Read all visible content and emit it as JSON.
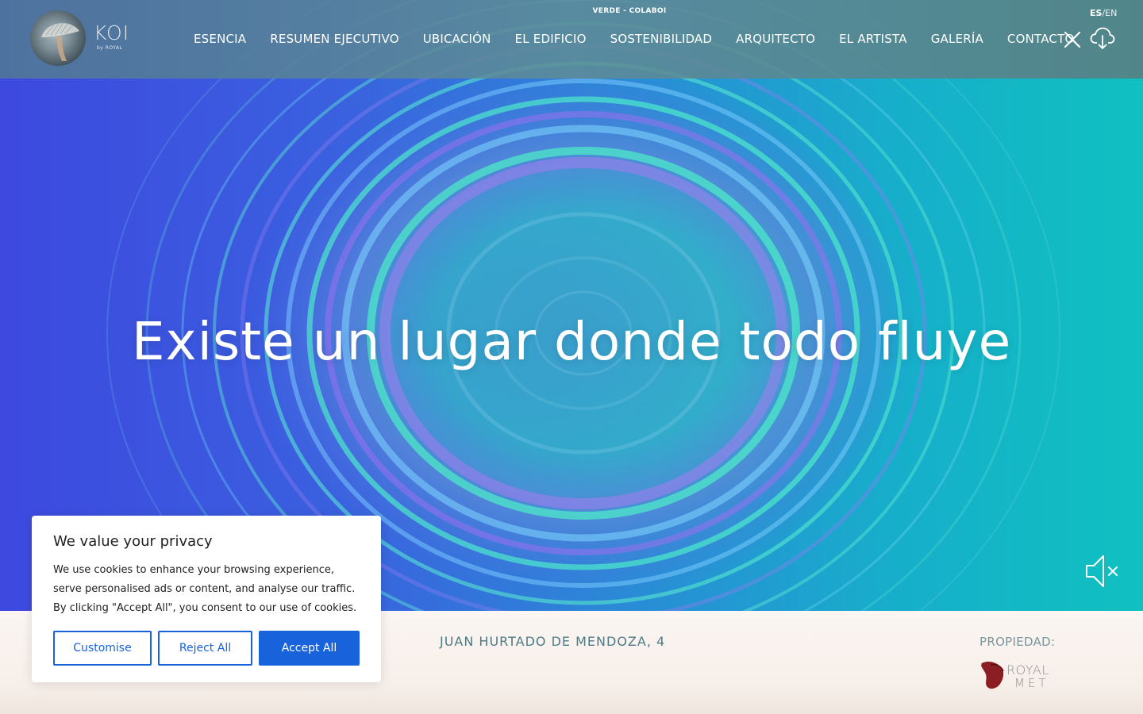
{
  "header": {
    "logo_word": "KOI",
    "logo_sub": "by ROYAL",
    "top_label": "VERDE - COLABOI",
    "nav": [
      {
        "label": "ESENCIA"
      },
      {
        "label": "RESUMEN EJECUTIVO"
      },
      {
        "label": "UBICACIÓN"
      },
      {
        "label": "EL EDIFICIO"
      },
      {
        "label": "SOSTENIBILIDAD"
      },
      {
        "label": "ARQUITECTO"
      },
      {
        "label": "EL ARTISTA"
      },
      {
        "label": "GALERÍA"
      },
      {
        "label": "CONTACTO"
      }
    ],
    "lang_active": "ES",
    "lang_sep": "/",
    "lang_inactive": "EN",
    "icons": [
      "close-icon",
      "cloud-download-icon"
    ]
  },
  "hero": {
    "title": "Existe un lugar donde todo fluye",
    "mute_icon": "speaker-muted-icon"
  },
  "info_bar": {
    "address": "JUAN HURTADO DE MENDOZA, 4",
    "property_label": "PROPIEDAD:",
    "property_logo_line1": "ROYAL",
    "property_logo_line2": "MET"
  },
  "cookie_banner": {
    "title": "We value your privacy",
    "text": "We use cookies to enhance your browsing experience, serve personalised ads or content, and analyse our traffic. By clicking \"Accept All\", you consent to our use of cookies.",
    "customise_label": "Customise",
    "reject_label": "Reject All",
    "accept_label": "Accept All"
  },
  "colors": {
    "accent_blue": "#1863dc",
    "address_teal": "#4d7a85",
    "royal_red": "#8b1e22"
  }
}
